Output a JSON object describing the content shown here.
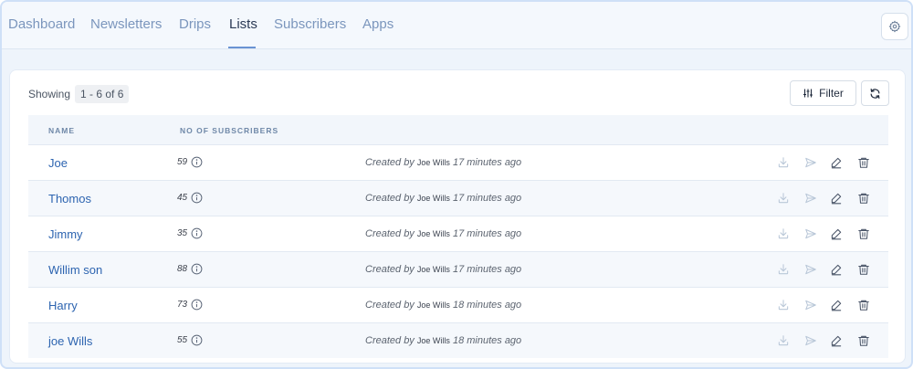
{
  "nav": {
    "tabs": [
      {
        "label": "Dashboard"
      },
      {
        "label": "Newsletters"
      },
      {
        "label": "Drips"
      },
      {
        "label": "Lists"
      },
      {
        "label": "Subscribers"
      },
      {
        "label": "Apps"
      }
    ],
    "active_tab": "Lists",
    "settings_icon": "gear-icon"
  },
  "toolbar": {
    "showing_label": "Showing",
    "range": "1 - 6 of 6",
    "filter_label": "Filter",
    "refresh_icon": "refresh-icon"
  },
  "table": {
    "headers": [
      "NAME",
      "NO OF SUBSCRIBERS"
    ],
    "created_prefix": "Created by",
    "rows": [
      {
        "name": "Joe",
        "subscribers": "59",
        "creator": "Joe Wills",
        "ago": "17 minutes ago"
      },
      {
        "name": "Thomos",
        "subscribers": "45",
        "creator": "Joe Wills",
        "ago": "17 minutes ago"
      },
      {
        "name": "Jimmy",
        "subscribers": "35",
        "creator": "Joe Wills",
        "ago": "17 minutes ago"
      },
      {
        "name": "Willim son",
        "subscribers": "88",
        "creator": "Joe Wills",
        "ago": "17 minutes ago"
      },
      {
        "name": "Harry",
        "subscribers": "73",
        "creator": "Joe Wills",
        "ago": "18 minutes ago"
      },
      {
        "name": "joe Wills",
        "subscribers": "55",
        "creator": "Joe Wills",
        "ago": "18 minutes ago"
      }
    ],
    "row_actions": [
      "download-icon",
      "send-icon",
      "edit-icon",
      "trash-icon"
    ]
  },
  "colors": {
    "accent": "#2d64b0",
    "nav_text": "#7b96bd",
    "nav_active": "#2b3a55",
    "muted_icon": "#b9c7d8",
    "dark_icon": "#4a5568"
  }
}
